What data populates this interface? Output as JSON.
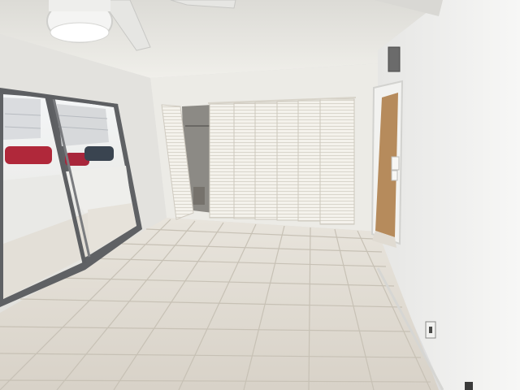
{
  "scene": {
    "kind": "photo",
    "subject": "empty-bedroom",
    "colors": {
      "ceiling": "#e9e8e3",
      "back_wall": "#eceae6",
      "left_wall": "#e2e1dd",
      "right_wall": "#f1f1ef",
      "floor_tile": "#ddd8cf",
      "grout": "#c9c3b8",
      "closet_door": "#f4f2ec",
      "closet_interior": "#8d8b86",
      "slider_frame": "#6f7174",
      "glass_tint": "#e8ecee",
      "outside_sky": "#f2f4f6",
      "car_red": "#b4283a",
      "fan_body": "#f3f3f3",
      "hall_door": "#b58a5d"
    }
  }
}
